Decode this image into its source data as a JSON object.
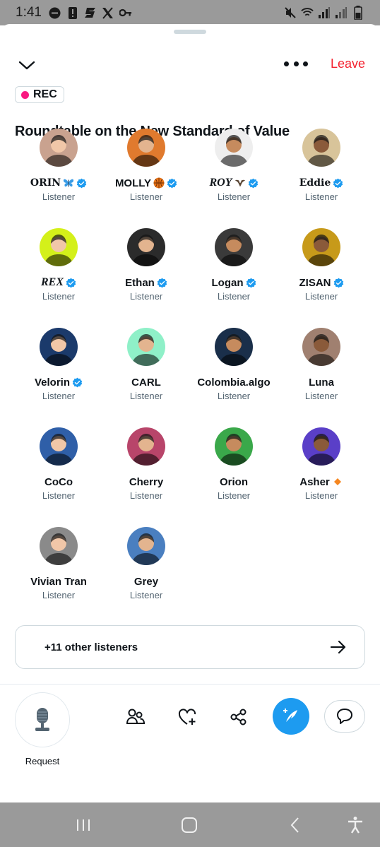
{
  "status_bar": {
    "time": "1:41",
    "left_icons": [
      "minus-circle-icon",
      "alert-icon",
      "s-logo-icon",
      "x-logo-icon",
      "key-icon"
    ],
    "right_icons": [
      "mute-icon",
      "wifi-icon",
      "signal-icon",
      "signal-icon",
      "battery-icon"
    ]
  },
  "header": {
    "leave_label": "Leave",
    "rec_label": "REC",
    "title": "Roundtable on the New Standard of Value"
  },
  "participants": [
    {
      "name": "ORIN",
      "role": "Listener",
      "verified": true,
      "style": "serif",
      "emoji": "butterfly-icon",
      "avatar_color": "#c9a28f"
    },
    {
      "name": "MOLLY",
      "role": "Listener",
      "verified": true,
      "style": "",
      "emoji": "basketball-icon",
      "avatar_color": "#e07a2e"
    },
    {
      "name": "ROY",
      "role": "Listener",
      "verified": true,
      "style": "ital",
      "emoji": "eagle-icon",
      "avatar_color": "#eeeeee"
    },
    {
      "name": "Eddie",
      "role": "Listener",
      "verified": true,
      "style": "serif",
      "emoji": "",
      "avatar_color": "#d8c49a"
    },
    {
      "name": "REX",
      "role": "Listener",
      "verified": true,
      "style": "ital",
      "emoji": "",
      "avatar_color": "#d4f01a"
    },
    {
      "name": "Ethan",
      "role": "Listener",
      "verified": true,
      "style": "",
      "emoji": "",
      "avatar_color": "#2b2b2b"
    },
    {
      "name": "Logan",
      "role": "Listener",
      "verified": true,
      "style": "",
      "emoji": "",
      "avatar_color": "#3a3a3a"
    },
    {
      "name": "ZISAN",
      "role": "Listener",
      "verified": true,
      "style": "",
      "emoji": "",
      "avatar_color": "#c79a1a"
    },
    {
      "name": "Velorin",
      "role": "Listener",
      "verified": true,
      "style": "",
      "emoji": "",
      "avatar_color": "#1b3a6b"
    },
    {
      "name": "CARL",
      "role": "Listener",
      "verified": false,
      "style": "",
      "emoji": "",
      "avatar_color": "#8ff0c8"
    },
    {
      "name": "Colombia.algo",
      "role": "Listener",
      "verified": false,
      "style": "",
      "emoji": "",
      "avatar_color": "#1a2f4a"
    },
    {
      "name": "Luna",
      "role": "Listener",
      "verified": false,
      "style": "",
      "emoji": "",
      "avatar_color": "#a08070"
    },
    {
      "name": "CoCo",
      "role": "Listener",
      "verified": false,
      "style": "",
      "emoji": "",
      "avatar_color": "#2f5fa8"
    },
    {
      "name": "Cherry",
      "role": "Listener",
      "verified": false,
      "style": "",
      "emoji": "",
      "avatar_color": "#b8456a"
    },
    {
      "name": "Orion",
      "role": "Listener",
      "verified": false,
      "style": "",
      "emoji": "",
      "avatar_color": "#3aa84a"
    },
    {
      "name": "Asher",
      "role": "Listener",
      "verified": false,
      "style": "",
      "emoji": "orange-diamond-icon",
      "avatar_color": "#5a3fc8"
    },
    {
      "name": "Vivian Tran",
      "role": "Listener",
      "verified": false,
      "style": "",
      "emoji": "",
      "avatar_color": "#8a8a8a"
    },
    {
      "name": "Grey",
      "role": "Listener",
      "verified": false,
      "style": "",
      "emoji": "",
      "avatar_color": "#4a7fc0"
    }
  ],
  "other_listeners": {
    "label": "+11 other listeners"
  },
  "bottom_bar": {
    "request_label": "Request",
    "icons": [
      "microphone-icon",
      "people-icon",
      "heart-plus-icon",
      "share-icon",
      "compose-icon",
      "chat-bubble-icon"
    ]
  },
  "colors": {
    "accent": "#1d9bf0",
    "leave": "#f4212e",
    "rec_dot": "#f91880",
    "secondary_text": "#536471"
  }
}
